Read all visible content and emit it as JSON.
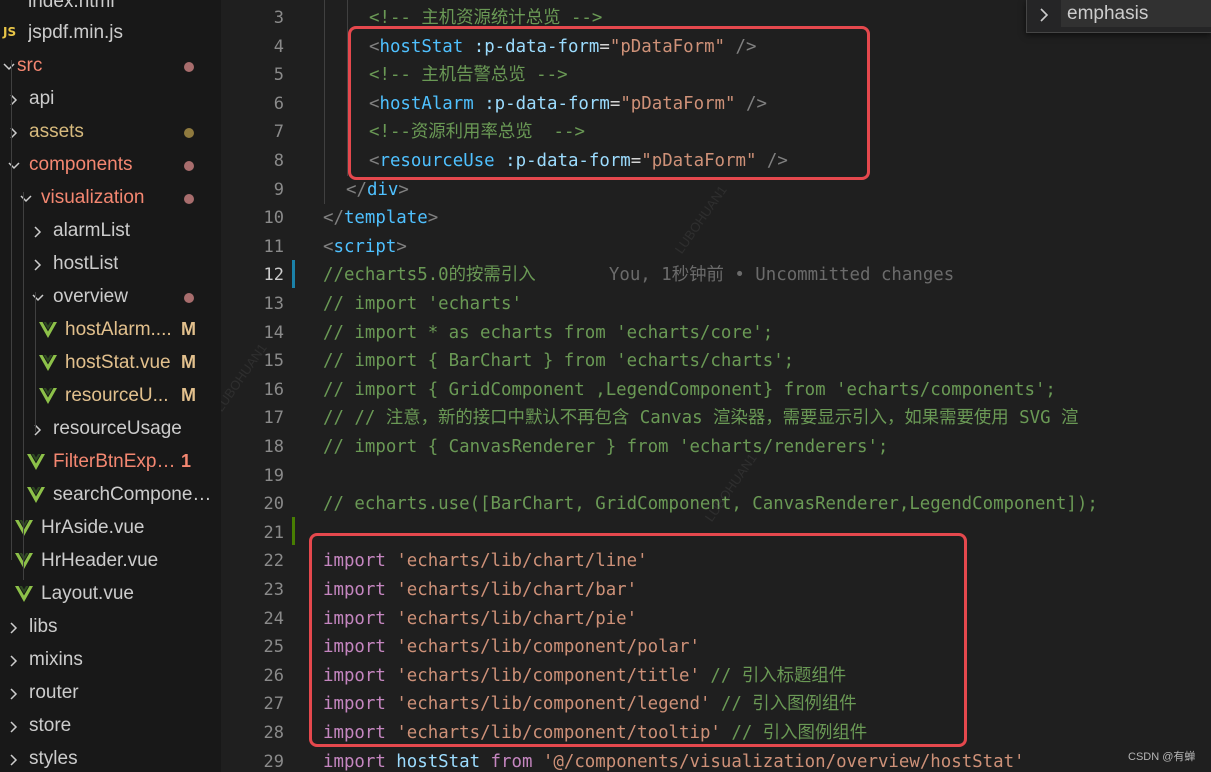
{
  "sidebar": {
    "items": [
      {
        "label": "index.html",
        "color": "#cccccc"
      },
      {
        "label": "jspdf.min.js",
        "color": "#cccccc",
        "icon": "js-file-icon",
        "icon_text": "JS"
      },
      {
        "label": "src",
        "color": "#f48771",
        "status": "modified-dot"
      },
      {
        "label": "api",
        "color": "#cccccc"
      },
      {
        "label": "assets",
        "color": "#d7ba7d",
        "status": "modified-dot"
      },
      {
        "label": "components",
        "color": "#f48771",
        "status": "modified-dot"
      },
      {
        "label": "visualization",
        "color": "#f48771",
        "status": "modified-dot"
      },
      {
        "label": "alarmList",
        "color": "#cccccc"
      },
      {
        "label": "hostList",
        "color": "#cccccc"
      },
      {
        "label": "overview",
        "color": "#cccccc",
        "status": "modified-dot"
      },
      {
        "label": "hostAlarm....",
        "color": "#e2c08d",
        "icon": "vue-file-icon",
        "badge": "M"
      },
      {
        "label": "hostStat.vue",
        "color": "#e2c08d",
        "icon": "vue-file-icon",
        "badge": "M"
      },
      {
        "label": "resourceU...",
        "color": "#e2c08d",
        "icon": "vue-file-icon",
        "badge": "M"
      },
      {
        "label": "resourceUsage",
        "color": "#cccccc"
      },
      {
        "label": "FilterBtnExpo...",
        "color": "#f48771",
        "icon": "vue-file-icon",
        "badge": "1"
      },
      {
        "label": "searchComponen...",
        "color": "#cccccc",
        "icon": "vue-file-icon"
      },
      {
        "label": "HrAside.vue",
        "color": "#cccccc",
        "icon": "vue-file-icon"
      },
      {
        "label": "HrHeader.vue",
        "color": "#cccccc",
        "icon": "vue-file-icon"
      },
      {
        "label": "Layout.vue",
        "color": "#cccccc",
        "icon": "vue-file-icon"
      },
      {
        "label": "libs",
        "color": "#cccccc"
      },
      {
        "label": "mixins",
        "color": "#cccccc"
      },
      {
        "label": "router",
        "color": "#cccccc"
      },
      {
        "label": "store",
        "color": "#cccccc"
      },
      {
        "label": "styles",
        "color": "#cccccc"
      }
    ]
  },
  "editor": {
    "active_line": "12",
    "lines": [
      {
        "num": "3",
        "tokens": [
          {
            "t": "<!-- 主机资源统计总览 -->",
            "c": "comment"
          }
        ]
      },
      {
        "num": "4",
        "tokens": [
          {
            "t": "<",
            "c": "bracket"
          },
          {
            "t": "hostStat",
            "c": "tag"
          },
          {
            "t": " :p-data-form",
            "c": "attr"
          },
          {
            "t": "=",
            "c": "op"
          },
          {
            "t": "\"pDataForm\"",
            "c": "str"
          },
          {
            "t": " />",
            "c": "bracket"
          }
        ]
      },
      {
        "num": "5",
        "tokens": [
          {
            "t": "<!-- 主机告警总览 -->",
            "c": "comment"
          }
        ]
      },
      {
        "num": "6",
        "tokens": [
          {
            "t": "<",
            "c": "bracket"
          },
          {
            "t": "hostAlarm",
            "c": "tag"
          },
          {
            "t": " :p-data-form",
            "c": "attr"
          },
          {
            "t": "=",
            "c": "op"
          },
          {
            "t": "\"pDataForm\"",
            "c": "str"
          },
          {
            "t": " />",
            "c": "bracket"
          }
        ]
      },
      {
        "num": "7",
        "tokens": [
          {
            "t": "<!--资源利用率总览  -->",
            "c": "comment"
          }
        ]
      },
      {
        "num": "8",
        "tokens": [
          {
            "t": "<",
            "c": "bracket"
          },
          {
            "t": "resourceUse",
            "c": "tag"
          },
          {
            "t": " :p-data-form",
            "c": "attr"
          },
          {
            "t": "=",
            "c": "op"
          },
          {
            "t": "\"pDataForm\"",
            "c": "str"
          },
          {
            "t": " />",
            "c": "bracket"
          }
        ]
      },
      {
        "num": "9",
        "tokens": [
          {
            "t": "</",
            "c": "bracket"
          },
          {
            "t": "div",
            "c": "tag"
          },
          {
            "t": ">",
            "c": "bracket"
          }
        ]
      },
      {
        "num": "10",
        "tokens": [
          {
            "t": "</",
            "c": "bracket"
          },
          {
            "t": "template",
            "c": "tag"
          },
          {
            "t": ">",
            "c": "bracket"
          }
        ]
      },
      {
        "num": "11",
        "tokens": [
          {
            "t": "<",
            "c": "bracket"
          },
          {
            "t": "script",
            "c": "tag"
          },
          {
            "t": ">",
            "c": "bracket"
          }
        ]
      },
      {
        "num": "12",
        "tokens": [
          {
            "t": "//echarts5.0的按需引入",
            "c": "comment"
          },
          {
            "t": "       You, 1秒钟前 • Uncommitted changes",
            "c": "blame"
          }
        ]
      },
      {
        "num": "13",
        "tokens": [
          {
            "t": "// import 'echarts'",
            "c": "comment"
          }
        ]
      },
      {
        "num": "14",
        "tokens": [
          {
            "t": "// import * as echarts from 'echarts/core';",
            "c": "comment"
          }
        ]
      },
      {
        "num": "15",
        "tokens": [
          {
            "t": "// import { BarChart } from 'echarts/charts';",
            "c": "comment"
          }
        ]
      },
      {
        "num": "16",
        "tokens": [
          {
            "t": "// import { GridComponent ,LegendComponent} from 'echarts/components';",
            "c": "comment"
          }
        ]
      },
      {
        "num": "17",
        "tokens": [
          {
            "t": "// // 注意，新的接口中默认不再包含 Canvas 渲染器，需要显示引入，如果需要使用 SVG 渲",
            "c": "comment"
          }
        ]
      },
      {
        "num": "18",
        "tokens": [
          {
            "t": "// import { CanvasRenderer } from 'echarts/renderers';",
            "c": "comment"
          }
        ]
      },
      {
        "num": "19",
        "tokens": []
      },
      {
        "num": "20",
        "tokens": [
          {
            "t": "// echarts.use([BarChart, GridComponent, CanvasRenderer,LegendComponent]);",
            "c": "comment"
          }
        ]
      },
      {
        "num": "21",
        "tokens": []
      },
      {
        "num": "22",
        "tokens": [
          {
            "t": "import",
            "c": "kw"
          },
          {
            "t": " ",
            "c": "op"
          },
          {
            "t": "'echarts/lib/chart/line'",
            "c": "str"
          }
        ]
      },
      {
        "num": "23",
        "tokens": [
          {
            "t": "import",
            "c": "kw"
          },
          {
            "t": " ",
            "c": "op"
          },
          {
            "t": "'echarts/lib/chart/bar'",
            "c": "str"
          }
        ]
      },
      {
        "num": "24",
        "tokens": [
          {
            "t": "import",
            "c": "kw"
          },
          {
            "t": " ",
            "c": "op"
          },
          {
            "t": "'echarts/lib/chart/pie'",
            "c": "str"
          }
        ]
      },
      {
        "num": "25",
        "tokens": [
          {
            "t": "import",
            "c": "kw"
          },
          {
            "t": " ",
            "c": "op"
          },
          {
            "t": "'echarts/lib/component/polar'",
            "c": "str"
          }
        ]
      },
      {
        "num": "26",
        "tokens": [
          {
            "t": "import",
            "c": "kw"
          },
          {
            "t": " ",
            "c": "op"
          },
          {
            "t": "'echarts/lib/component/title'",
            "c": "str"
          },
          {
            "t": " // 引入标题组件",
            "c": "comment"
          }
        ]
      },
      {
        "num": "27",
        "tokens": [
          {
            "t": "import",
            "c": "kw"
          },
          {
            "t": " ",
            "c": "op"
          },
          {
            "t": "'echarts/lib/component/legend'",
            "c": "str"
          },
          {
            "t": " // 引入图例组件",
            "c": "comment"
          }
        ]
      },
      {
        "num": "28",
        "tokens": [
          {
            "t": "import",
            "c": "kw"
          },
          {
            "t": " ",
            "c": "op"
          },
          {
            "t": "'echarts/lib/component/tooltip'",
            "c": "str"
          },
          {
            "t": " // 引入图例组件",
            "c": "comment"
          }
        ]
      },
      {
        "num": "29",
        "tokens": [
          {
            "t": "import",
            "c": "kw"
          },
          {
            "t": " hostStat",
            "c": "var"
          },
          {
            "t": " from",
            "c": "kw"
          },
          {
            "t": " ",
            "c": "op"
          },
          {
            "t": "'@/components/visualization/overview/hostStat'",
            "c": "str"
          }
        ]
      }
    ]
  },
  "find_widget": {
    "value": "emphasis"
  },
  "watermark": {
    "text": "CSDN @有蝉"
  },
  "colors": {
    "highlight_box": "#e5484d",
    "git_added": "#487e02",
    "git_modified": "#1b81a8",
    "vue_icon": "#8dc149",
    "modified_dot": "#a86d6d",
    "assets_dot": "#8f7a3e"
  }
}
